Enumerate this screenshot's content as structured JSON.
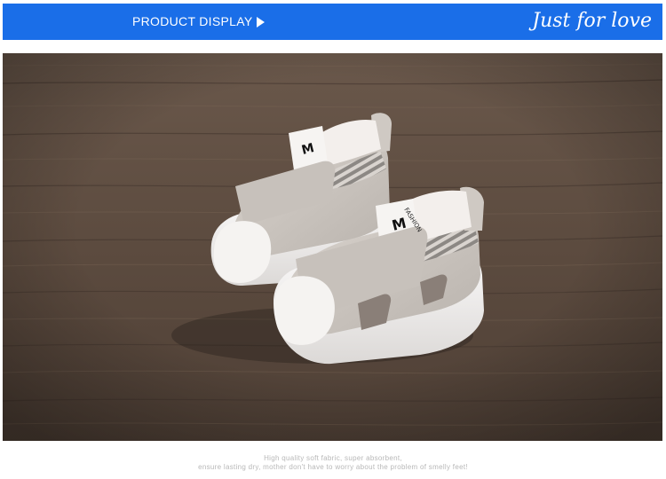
{
  "header": {
    "title": "PRODUCT DISPLAY",
    "arrow_icon": "triangle-right-icon",
    "slogan": "Just for love",
    "bar_color": "#1a6ee8"
  },
  "photo": {
    "tongue_label": "FASHION",
    "logo_letter": "M"
  },
  "caption": {
    "line1": "High quality soft fabric, super absorbent,",
    "line2": "ensure lasting dry, mother don't have to worry about the problem of smelly feet!"
  }
}
